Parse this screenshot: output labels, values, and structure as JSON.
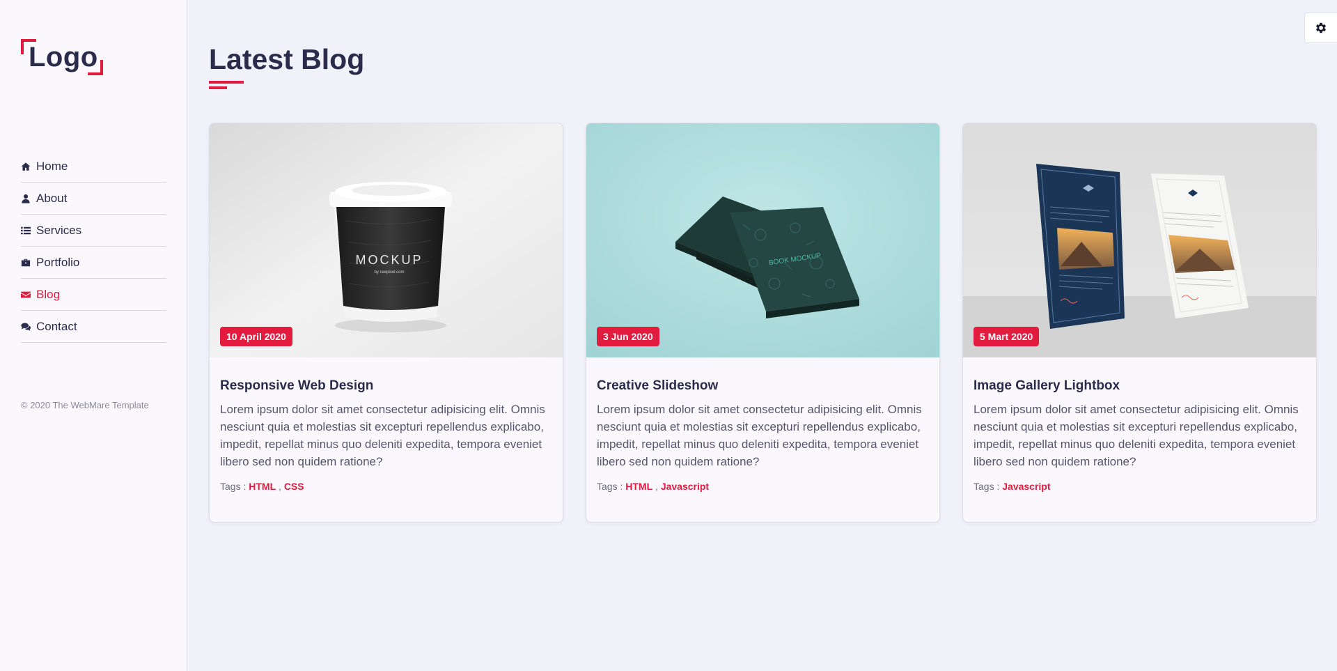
{
  "sidebar": {
    "logo": "Logo",
    "nav": [
      {
        "label": "Home",
        "icon": "home-icon"
      },
      {
        "label": "About",
        "icon": "user-icon"
      },
      {
        "label": "Services",
        "icon": "list-icon"
      },
      {
        "label": "Portfolio",
        "icon": "briefcase-icon"
      },
      {
        "label": "Blog",
        "icon": "envelope-icon",
        "active": true
      },
      {
        "label": "Contact",
        "icon": "comments-icon"
      }
    ],
    "copyright": "© 2020 The WebMare Template"
  },
  "settings": {
    "icon": "gear-icon"
  },
  "main": {
    "title": "Latest Blog",
    "posts": [
      {
        "date": "10 April 2020",
        "title": "Responsive Web Design",
        "text": "Lorem ipsum dolor sit amet consectetur adipisicing elit. Omnis nesciunt quia et molestias sit excepturi repellendus explicabo, impedit, repellat minus quo deleniti expedita, tempora eveniet libero sed non quidem ratione?",
        "tags_label": "Tags :",
        "tags": [
          "HTML",
          "CSS"
        ],
        "image": "coffee-cup-mockup",
        "image_text": "MOCKUP",
        "image_subtext": "by rawpixel.com"
      },
      {
        "date": "3 Jun 2020",
        "title": "Creative Slideshow",
        "text": "Lorem ipsum dolor sit amet consectetur adipisicing elit. Omnis nesciunt quia et molestias sit excepturi repellendus explicabo, impedit, repellat minus quo deleniti expedita, tempora eveniet libero sed non quidem ratione?",
        "tags_label": "Tags :",
        "tags": [
          "HTML",
          "Javascript"
        ],
        "image": "book-mockup",
        "image_text": "BOOK MOCKUP"
      },
      {
        "date": "5 Mart 2020",
        "title": "Image Gallery Lightbox",
        "text": "Lorem ipsum dolor sit amet consectetur adipisicing elit. Omnis nesciunt quia et molestias sit excepturi repellendus explicabo, impedit, repellat minus quo deleniti expedita, tempora eveniet libero sed non quidem ratione?",
        "tags_label": "Tags :",
        "tags": [
          "Javascript"
        ],
        "image": "letterhead-mockup"
      }
    ]
  },
  "colors": {
    "accent": "#e31b3f",
    "text": "#2b2c4b",
    "background": "#f0f1f9"
  }
}
